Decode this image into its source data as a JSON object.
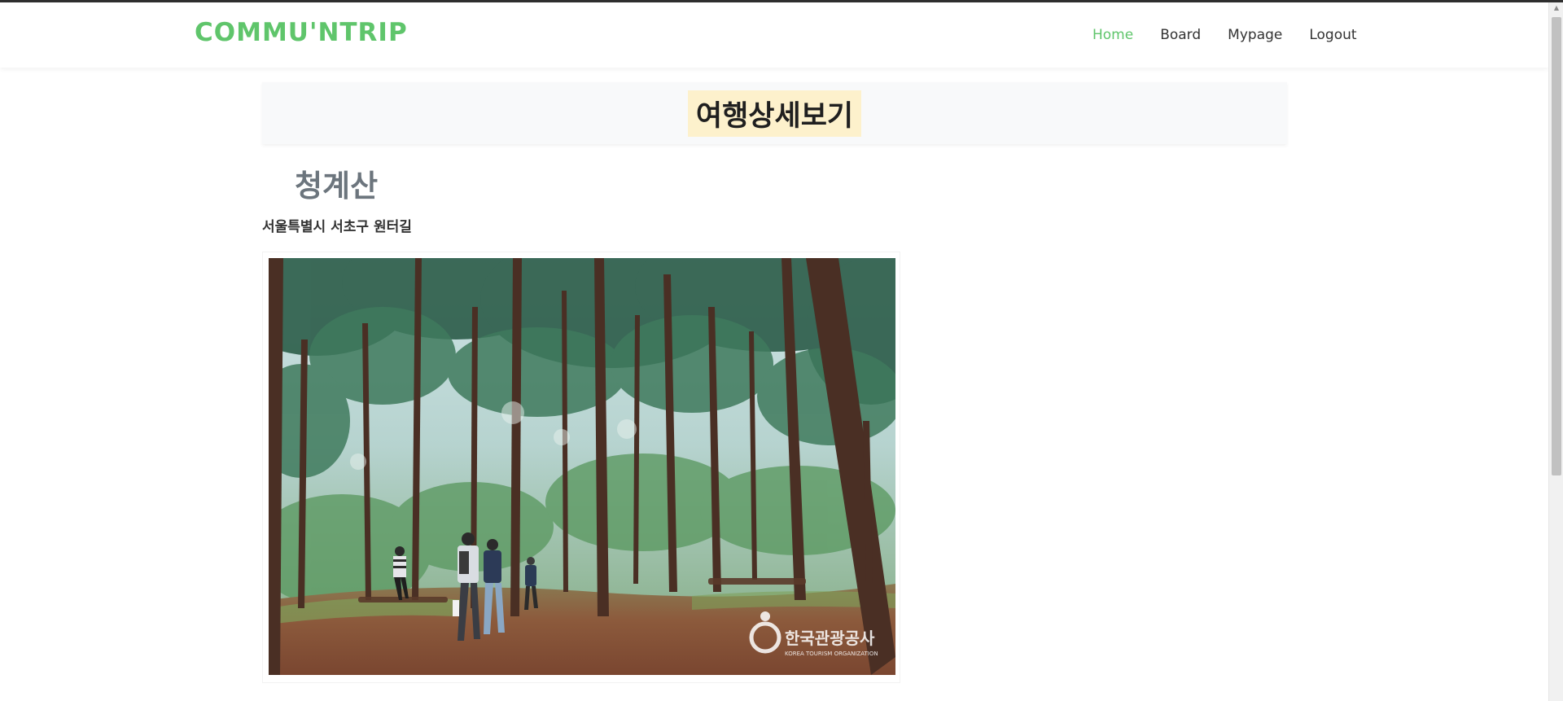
{
  "navbar": {
    "brand": "COMMU'NTRIP",
    "links": [
      "Home",
      "Board",
      "Mypage",
      "Logout"
    ],
    "active_link": "Home",
    "accent_color": "#5fc56b"
  },
  "header": {
    "title": "여행상세보기",
    "highlight_color": "#fdf1cc"
  },
  "place": {
    "name": "청계산",
    "address": "서울특별시 서초구 원터길",
    "image": {
      "subject": "pine forest trail with hikers",
      "watermark_text": "한국관광공사",
      "watermark_subtext": "KOREA TOURISM ORGANIZATION"
    }
  },
  "icons": {
    "scroll_up": "chevron-up-icon",
    "scroll_down": "chevron-down-icon"
  }
}
